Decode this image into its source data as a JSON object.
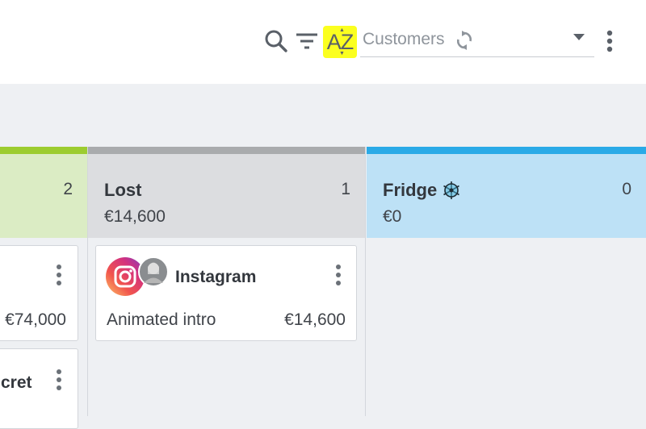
{
  "toolbar": {
    "sort_label": "AZ",
    "customer_select": {
      "value": "Customers"
    },
    "icons": [
      "search-icon",
      "filter-icon",
      "sort-az-icon",
      "refresh-icon",
      "chevron-down-icon",
      "more-vertical-icon"
    ],
    "sort_highlight_color": "#fbff1f"
  },
  "columns": [
    {
      "id": "won",
      "name": "",
      "count": "2",
      "amount": "",
      "color": "#9ccc2f"
    },
    {
      "id": "lost",
      "name": "Lost",
      "count": "1",
      "amount": "€14,600",
      "color": "#a9abad"
    },
    {
      "id": "fridge",
      "name": "Fridge",
      "count": "0",
      "amount": "€0",
      "color": "#2aaae7",
      "icon": "snowflake-icon"
    }
  ],
  "cards": {
    "won_1": {
      "amount": "€74,000"
    },
    "won_2": {
      "title_fragment": "cret"
    },
    "lost_1": {
      "title": "Instagram",
      "description": "Animated intro",
      "amount": "€14,600",
      "icons": [
        "instagram-logo-icon",
        "user-avatar"
      ]
    }
  }
}
